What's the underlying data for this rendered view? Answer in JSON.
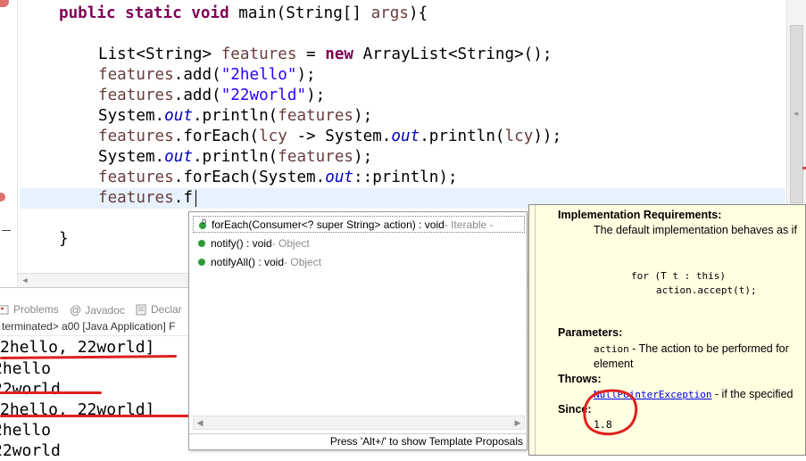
{
  "editor": {
    "lines": {
      "l1_kw": "public static void",
      "l1_rest": " main(String[] ",
      "l1_var": "args",
      "l1_end": "){",
      "l2_pre": "List<String> ",
      "l2_var": "features",
      "l2_mid": " = ",
      "l2_kw": "new",
      "l2_end": " ArrayList<String>();",
      "l3_var": "features",
      "l3_a": ".add(",
      "l3_str": "\"2hello\"",
      "l3_end": ");",
      "l4_var": "features",
      "l4_a": ".add(",
      "l4_str": "\"22world\"",
      "l4_end": ");",
      "l5_a": "System.",
      "l5_fld": "out",
      "l5_b": ".println(",
      "l5_var": "features",
      "l5_end": ");",
      "l6_var": "features",
      "l6_a": ".forEach(",
      "l6_var2": "lcy",
      "l6_b": " -> System.",
      "l6_fld": "out",
      "l6_c": ".println(",
      "l6_var3": "lcy",
      "l6_end": "));",
      "l7_a": "System.",
      "l7_fld": "out",
      "l7_b": ".println(",
      "l7_var": "features",
      "l7_end": ");",
      "l8_var": "features",
      "l8_a": ".forEach(System.",
      "l8_fld": "out",
      "l8_end": "::println);",
      "l9_var": "features",
      "l9_end": ".f",
      "l10": "}"
    }
  },
  "bottom_panel": {
    "tabs": {
      "problems": "Problems",
      "javadoc": "Javadoc",
      "declaration": "Declar"
    },
    "console_header": "terminated> a00 [Java Application] F",
    "output": [
      "2hello, 22world]",
      "2hello",
      "22world",
      "2hello, 22world]",
      "2hello",
      "22world"
    ]
  },
  "completion": {
    "items": [
      {
        "name": "forEach(Consumer<? super String> action) : void",
        "type": " - Iterable -"
      },
      {
        "name": "notify() : void",
        "type": " - Object"
      },
      {
        "name": "notifyAll() : void",
        "type": " - Object"
      }
    ],
    "footer": "Press 'Alt+/' to show Template Proposals"
  },
  "doc": {
    "impl_req_heading": "Implementation Requirements:",
    "impl_req_text": "The default implementation behaves as if",
    "code1": "for (T t : this)",
    "code2": "action.accept(t);",
    "params_heading": "Parameters:",
    "param_name": "action",
    "param_text": " - The action to be performed for",
    "param_text2": "element",
    "throws_heading": "Throws:",
    "throws_link": "NullPointerException",
    "throws_text": " - if the specified",
    "since_heading": "Since:",
    "since_value": "1.8"
  },
  "colors": {
    "keyword": "#7f0055",
    "field": "#0000c0",
    "string": "#2a00ff",
    "variable": "#6a3e3e",
    "annotation_red": "#e02020",
    "doc_bg": "#ffffe1"
  }
}
